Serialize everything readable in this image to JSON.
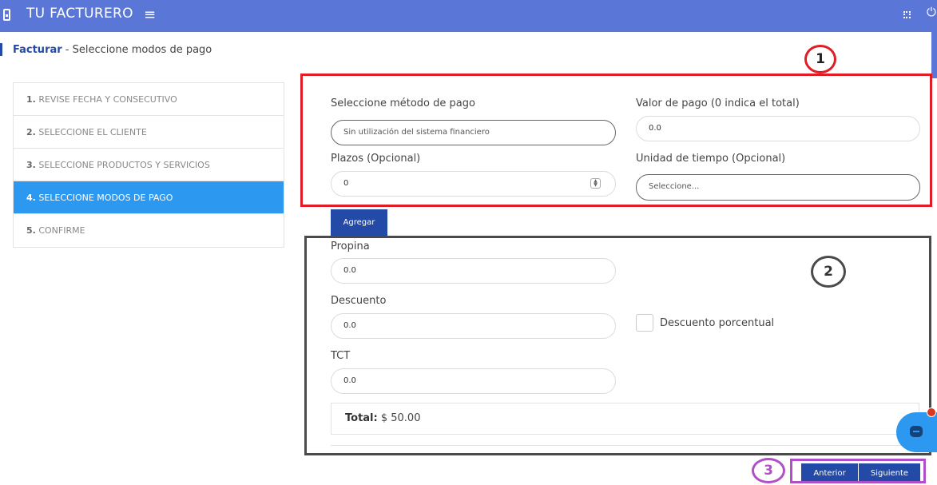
{
  "app": {
    "title": "TU FACTURERO"
  },
  "icons": {
    "logo": "receipt-icon",
    "menu": "hamburger-icon",
    "fullscreen": "fullscreen-icon",
    "power": "power-icon",
    "chat": "chat-icon"
  },
  "colors": {
    "header": "#5a76d6",
    "active_step": "#2d98f0",
    "button": "#234aa6",
    "annotation_1": "#e01c24",
    "annotation_2": "#4a4a4a",
    "annotation_3": "#b14fc9"
  },
  "breadcrumb": {
    "main": "Facturar",
    "separator": " - ",
    "sub": "Seleccione modos de pago"
  },
  "steps": [
    {
      "num": "1.",
      "label": "REVISE FECHA Y CONSECUTIVO",
      "active": false
    },
    {
      "num": "2.",
      "label": "SELECCIONE EL CLIENTE",
      "active": false
    },
    {
      "num": "3.",
      "label": "SELECCIONE PRODUCTOS Y SERVICIOS",
      "active": false
    },
    {
      "num": "4.",
      "label": "SELECCIONE MODOS DE PAGO",
      "active": true
    },
    {
      "num": "5.",
      "label": "CONFIRME",
      "active": false
    }
  ],
  "payment": {
    "method_label": "Seleccione método de pago",
    "method_value": "Sin utilización del sistema financiero",
    "amount_label": "Valor de pago (0 indica el total)",
    "amount_value": "0.0",
    "installments_label": "Plazos (Opcional)",
    "installments_value": "0",
    "time_unit_label": "Unidad de tiempo (Opcional)",
    "time_unit_placeholder": "Seleccione...",
    "add_button": "Agregar"
  },
  "extras": {
    "tip_label": "Propina",
    "tip_value": "0.0",
    "discount_label": "Descuento",
    "discount_value": "0.0",
    "discount_percent_label": "Descuento porcentual",
    "tct_label": "TCT",
    "tct_value": "0.0",
    "total_label": "Total:",
    "total_value": " $ 50.00"
  },
  "nav": {
    "prev": "Anterior",
    "next": "Siguiente"
  },
  "annotations": [
    "1",
    "2",
    "3"
  ]
}
